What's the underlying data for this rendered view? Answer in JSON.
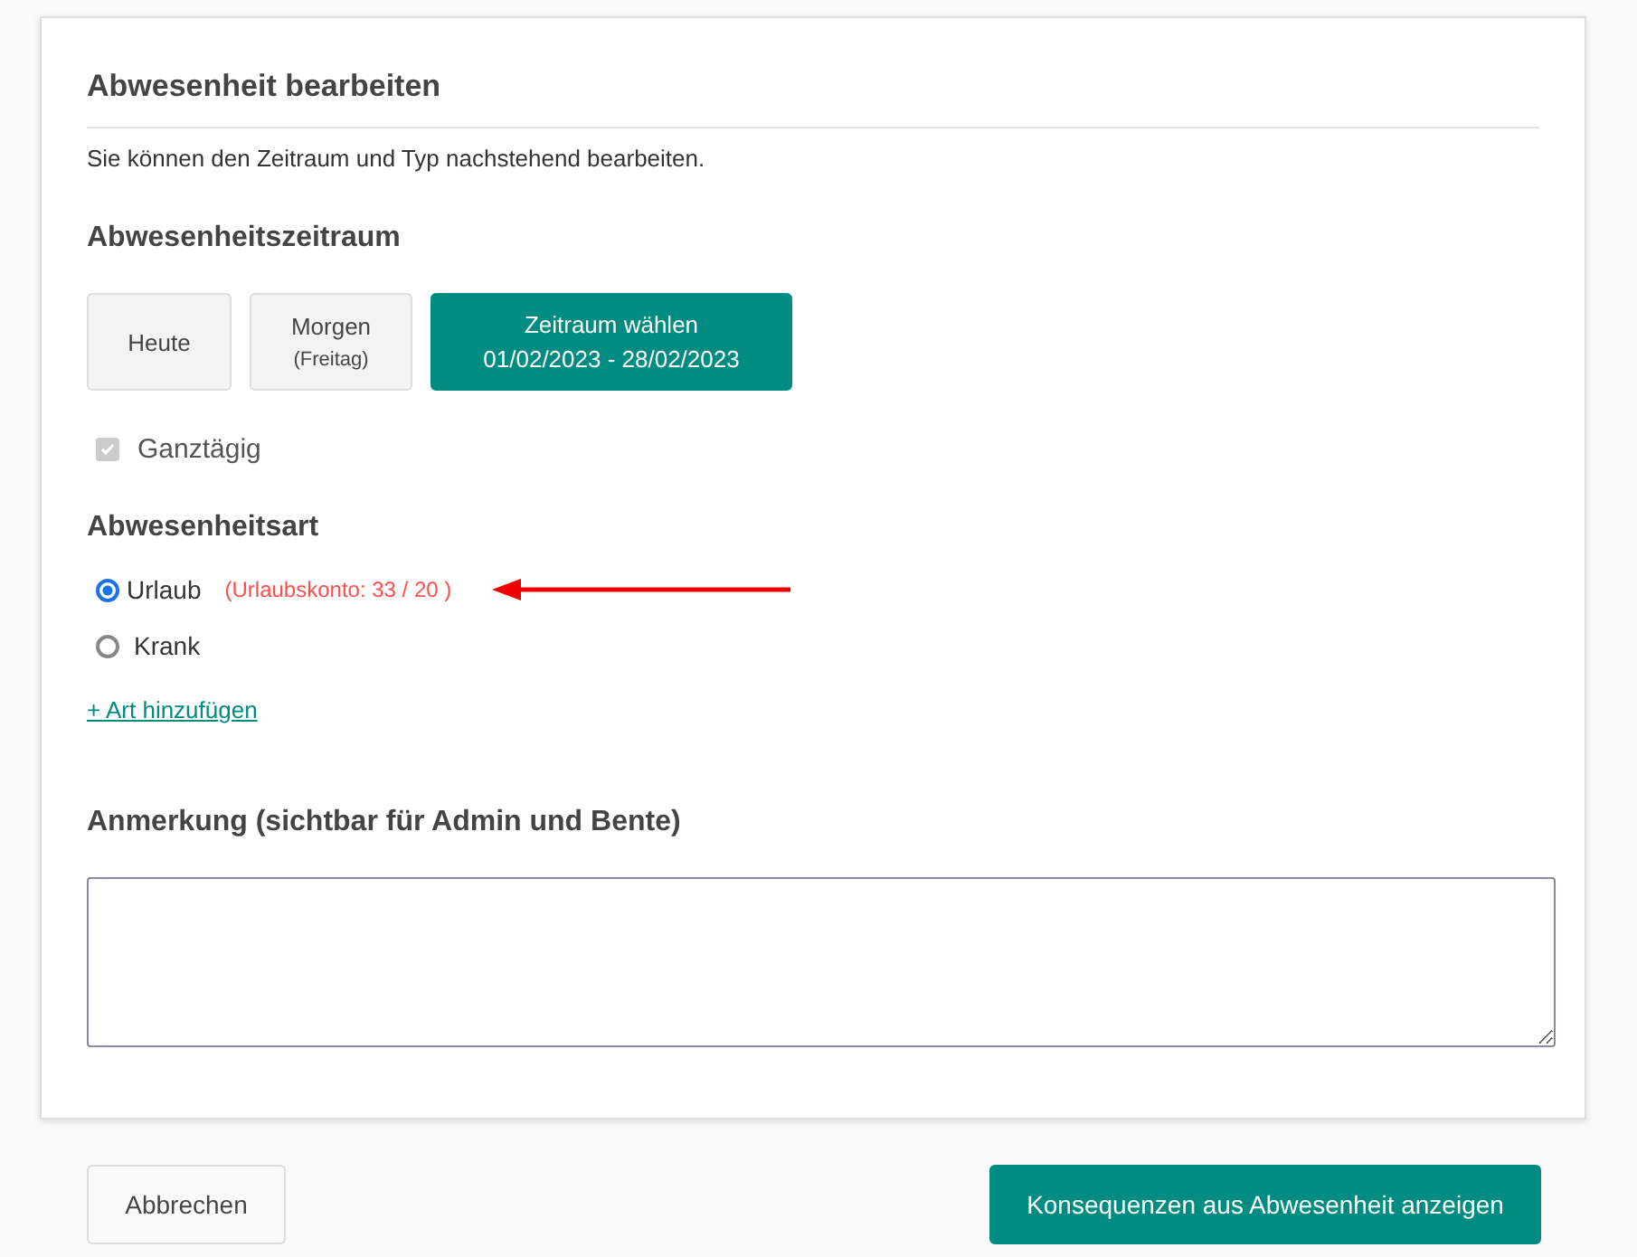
{
  "dialog": {
    "title": "Abwesenheit bearbeiten",
    "description": "Sie können den Zeitraum und Typ nachstehend bearbeiten."
  },
  "period": {
    "heading": "Abwesenheitszeitraum",
    "options": [
      {
        "label": "Heute",
        "selected": false
      },
      {
        "label": "Morgen",
        "sublabel": "(Freitag)",
        "selected": false
      },
      {
        "label": "Zeitraum wählen",
        "sublabel": "01/02/2023 - 28/02/2023",
        "selected": true
      }
    ],
    "all_day": {
      "label": "Ganztägig",
      "checked": true,
      "disabled": true
    }
  },
  "type": {
    "heading": "Abwesenheitsart",
    "options": [
      {
        "label": "Urlaub",
        "note": "(Urlaubskonto: 33 / 20 )",
        "selected": true
      },
      {
        "label": "Krank",
        "selected": false
      }
    ],
    "add_link": "+ Art hinzufügen"
  },
  "note": {
    "heading": "Anmerkung (sichtbar für Admin und Bente)"
  },
  "buttons": [
    {
      "label": "Abbrechen",
      "kind": "secondary"
    },
    {
      "label": "Konsequenzen aus Abwesenheit anzeigen",
      "kind": "primary"
    }
  ]
}
